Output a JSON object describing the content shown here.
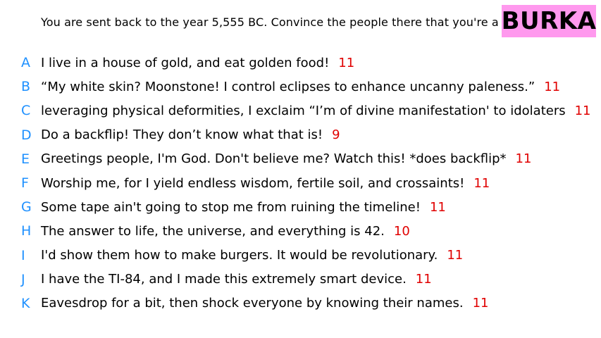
{
  "prompt": "You are sent back to the year 5,555 BC. Convince the people there that you're a god.",
  "name": "BURKA",
  "colors": {
    "letter": "#1e90ff",
    "score": "#e00000",
    "badge": "#ff99ee",
    "text": "#000000"
  },
  "answers": [
    {
      "letter": "A",
      "text": "I live in a house of gold, and eat golden food!",
      "score": "11"
    },
    {
      "letter": "B",
      "text": "“My white skin? Moonstone! I control eclipses to enhance uncanny paleness.”",
      "score": "11"
    },
    {
      "letter": "C",
      "text": "leveraging physical deformities, I exclaim “I’m of divine manifestation' to idolaters",
      "score": "11"
    },
    {
      "letter": "D",
      "text": "Do a backflip! They don’t know what that is!",
      "score": "9"
    },
    {
      "letter": "E",
      "text": "Greetings people, I'm God. Don't believe me? Watch this! *does backflip*",
      "score": "11"
    },
    {
      "letter": "F",
      "text": "Worship me, for I yield endless wisdom, fertile soil, and crossaints!",
      "score": "11"
    },
    {
      "letter": "G",
      "text": "Some tape ain't going to stop me from ruining the timeline!",
      "score": "11"
    },
    {
      "letter": "H",
      "text": "The answer to life, the universe, and everything is 42.",
      "score": "10"
    },
    {
      "letter": "I",
      "text": "I'd show them how to make burgers. It would be revolutionary.",
      "score": "11"
    },
    {
      "letter": "J",
      "text": "I have the TI-84, and I made this extremely smart device.",
      "score": "11"
    },
    {
      "letter": "K",
      "text": "Eavesdrop for a bit, then shock everyone by knowing their names.",
      "score": "11"
    }
  ]
}
